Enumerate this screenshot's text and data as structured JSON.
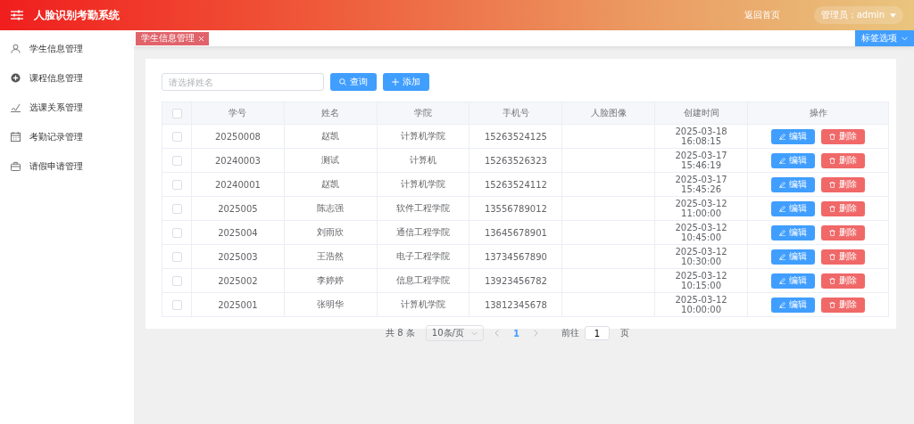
{
  "header": {
    "title": "人脸识别考勤系统",
    "home_link": "返回首页",
    "user_menu": "管理员：admin"
  },
  "sidebar": {
    "items": [
      {
        "label": "学生信息管理"
      },
      {
        "label": "课程信息管理"
      },
      {
        "label": "选课关系管理"
      },
      {
        "label": "考勤记录管理"
      },
      {
        "label": "请假申请管理"
      }
    ]
  },
  "tabs": [
    {
      "label": "学生信息管理",
      "selected": true
    }
  ],
  "tab_options": "标签选项",
  "search": {
    "placeholder": "请选择姓名"
  },
  "buttons": {
    "query": "查询",
    "add": "添加"
  },
  "table": {
    "columns": [
      "学号",
      "姓名",
      "学院",
      "手机号",
      "人脸图像",
      "创建时间",
      "操作"
    ],
    "header_checked": false,
    "rows": [
      {
        "checked": false,
        "id": "20250008",
        "name": "赵凯",
        "college": "计算机学院",
        "phone": "15263524125",
        "created": "2025-03-18 16:08:15",
        "edit": "编辑",
        "delete": "删除"
      },
      {
        "checked": false,
        "id": "20240003",
        "name": "测试",
        "college": "计算机",
        "phone": "15263526323",
        "created": "2025-03-17 15:46:19",
        "edit": "编辑",
        "delete": "删除"
      },
      {
        "checked": false,
        "id": "20240001",
        "name": "赵凯",
        "college": "计算机学院",
        "phone": "15263524112",
        "created": "2025-03-17 15:45:26",
        "edit": "编辑",
        "delete": "删除"
      },
      {
        "checked": false,
        "id": "2025005",
        "name": "陈志强",
        "college": "软件工程学院",
        "phone": "13556789012",
        "created": "2025-03-12 11:00:00",
        "edit": "编辑",
        "delete": "删除"
      },
      {
        "checked": false,
        "id": "2025004",
        "name": "刘雨欣",
        "college": "通信工程学院",
        "phone": "13645678901",
        "created": "2025-03-12 10:45:00",
        "edit": "编辑",
        "delete": "删除"
      },
      {
        "checked": false,
        "id": "2025003",
        "name": "王浩然",
        "college": "电子工程学院",
        "phone": "13734567890",
        "created": "2025-03-12 10:30:00",
        "edit": "编辑",
        "delete": "删除"
      },
      {
        "checked": false,
        "id": "2025002",
        "name": "李婷婷",
        "college": "信息工程学院",
        "phone": "13923456782",
        "created": "2025-03-12 10:15:00",
        "edit": "编辑",
        "delete": "删除"
      },
      {
        "checked": false,
        "id": "2025001",
        "name": "张明华",
        "college": "计算机学院",
        "phone": "13812345678",
        "created": "2025-03-12 10:00:00",
        "edit": "编辑",
        "delete": "删除"
      }
    ]
  },
  "pagination": {
    "total": "共 8 条",
    "page_size": "10条/页",
    "pages": [
      {
        "label": "1",
        "selected": true
      }
    ],
    "goto_label": "前往",
    "goto_value": "1",
    "goto_suffix": "页"
  }
}
